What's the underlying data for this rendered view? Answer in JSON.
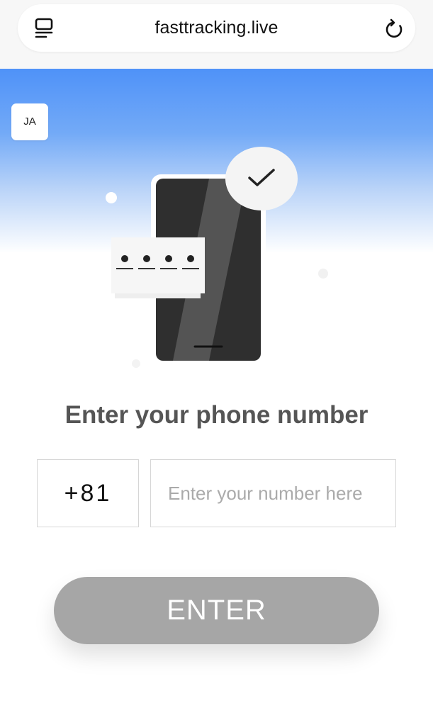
{
  "browser": {
    "url": "fasttracking.live"
  },
  "language": {
    "label": "JA"
  },
  "form": {
    "title": "Enter your phone number",
    "country_code": "+81",
    "phone_placeholder": "Enter your number here",
    "phone_value": "",
    "submit_label": "ENTER"
  },
  "colors": {
    "hero_top": "#4f92f8",
    "button_disabled": "#a6a6a6",
    "title_text": "#555555"
  },
  "icons": {
    "reader": "reader-mode-icon",
    "reload": "reload-icon",
    "check": "checkmark-icon",
    "phone": "smartphone-illustration"
  }
}
